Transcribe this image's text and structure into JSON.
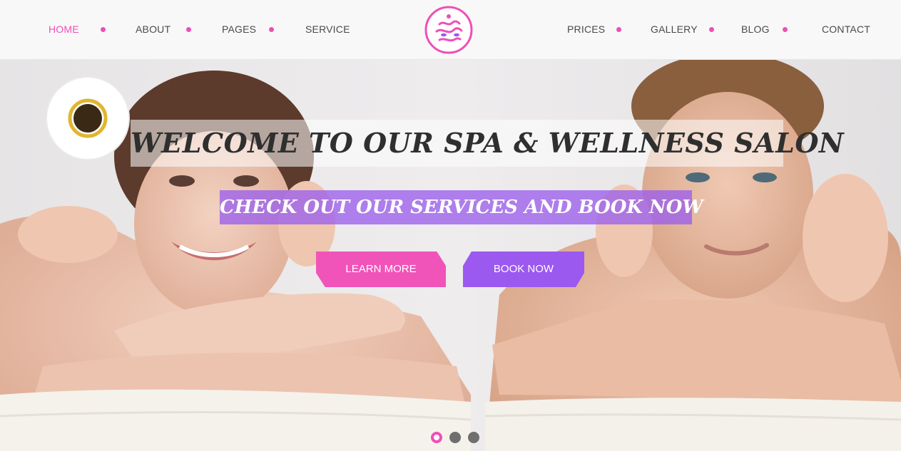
{
  "nav": {
    "left": [
      {
        "label": "HOME",
        "active": true
      },
      {
        "label": "ABOUT",
        "active": false
      },
      {
        "label": "PAGES",
        "active": false
      },
      {
        "label": "SERVICE",
        "active": false
      }
    ],
    "right": [
      {
        "label": "PRICES",
        "active": false
      },
      {
        "label": "GALLERY",
        "active": false
      },
      {
        "label": "BLOG",
        "active": false
      },
      {
        "label": "CONTACT",
        "active": false
      }
    ]
  },
  "logo": {
    "icon": "lotus-waves-logo-icon"
  },
  "hero": {
    "headline": "WELCOME TO OUR SPA & WELLNESS SALON",
    "subheadline": "CHECK OUT OUR SERVICES AND BOOK NOW",
    "buttons": {
      "learn_more": "LEARN MORE",
      "book_now": "BOOK NOW"
    },
    "slider": {
      "total": 3,
      "current": 1
    }
  },
  "colors": {
    "accent_pink": "#ee4fb7",
    "accent_purple": "#9b59f0",
    "nav_text": "#4a4a4a",
    "header_bg": "#f8f8f8"
  }
}
